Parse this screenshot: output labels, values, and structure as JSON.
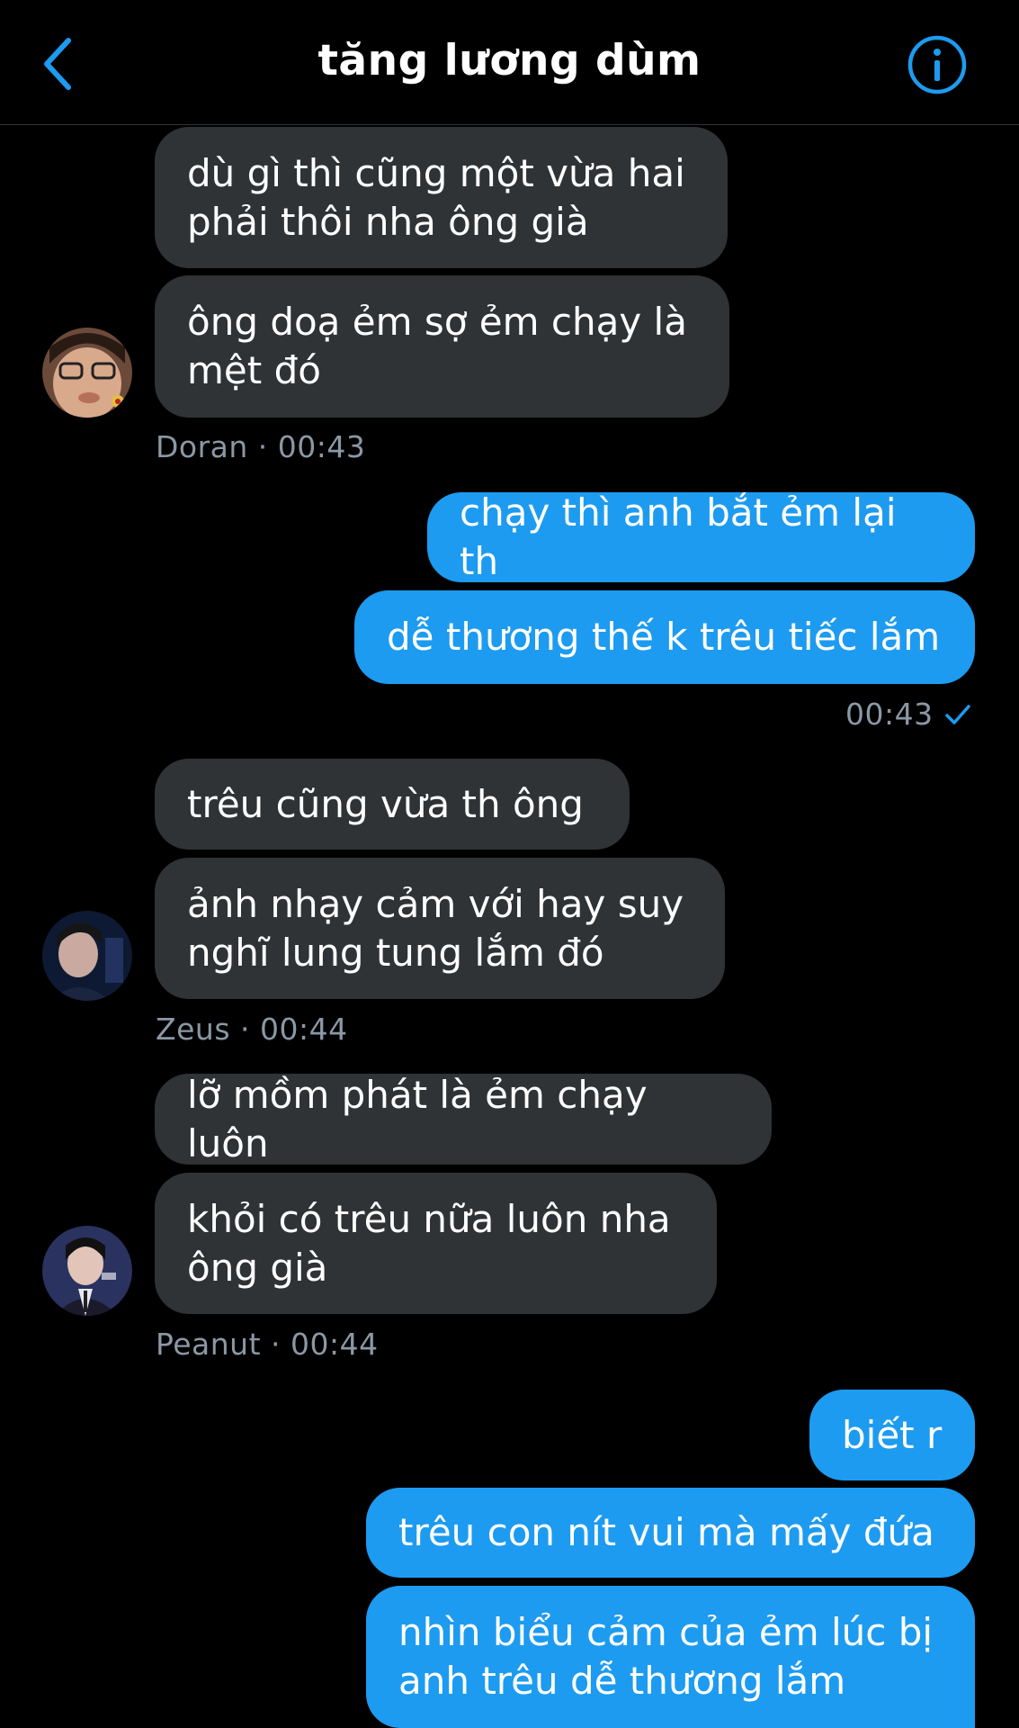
{
  "header": {
    "title": "tăng lương dùm",
    "back_icon": "chevron-left-icon",
    "info_icon": "info-icon",
    "accent_color": "#1d9bf0"
  },
  "messages": [
    {
      "side": "in",
      "text": "dù gì thì cũng một vừa hai\nphải thôi nha ông già"
    },
    {
      "side": "in",
      "text": "ông doạ ẻm sợ ẻm chạy là\nmệt đó"
    },
    {
      "side": "meta",
      "sender": "Doran",
      "time": "00:43"
    },
    {
      "side": "out",
      "text": "chạy thì anh bắt ẻm lại th"
    },
    {
      "side": "out",
      "text": "dễ thương thế k trêu tiếc lắm"
    },
    {
      "side": "meta-out",
      "time": "00:43",
      "status_icon": "check-icon"
    },
    {
      "side": "in",
      "text": "trêu cũng vừa th ông"
    },
    {
      "side": "in",
      "text": "ảnh nhạy cảm với hay suy\nnghĩ lung tung lắm đó"
    },
    {
      "side": "meta",
      "sender": "Zeus",
      "time": "00:44"
    },
    {
      "side": "in",
      "text": "lỡ mồm phát là ẻm chạy luôn"
    },
    {
      "side": "in",
      "text": "khỏi có trêu nữa luôn nha\nông già"
    },
    {
      "side": "meta",
      "sender": "Peanut",
      "time": "00:44"
    },
    {
      "side": "out",
      "text": "biết r"
    },
    {
      "side": "out",
      "text": "trêu con nít vui mà mấy đứa"
    },
    {
      "side": "out",
      "text": "nhìn biểu cảm của ẻm lúc bị\nanh trêu dễ thương lắm"
    }
  ],
  "meta_lines": {
    "doran": "Doran · 00:43",
    "zeus": "Zeus · 00:44",
    "peanut": "Peanut · 00:44"
  }
}
